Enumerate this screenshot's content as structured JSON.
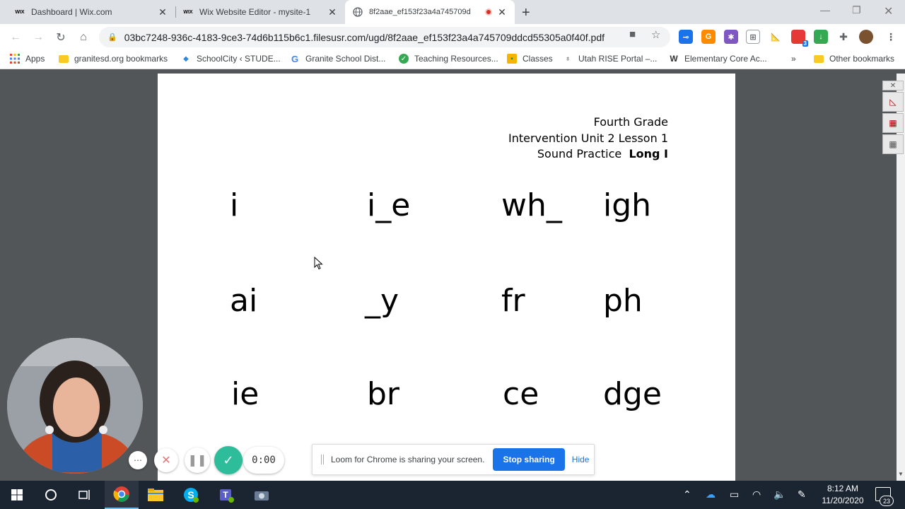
{
  "tabs": [
    {
      "title": "Dashboard | Wix.com",
      "favicon": "wix-icon",
      "favicon_text": "WIX"
    },
    {
      "title": "Wix Website Editor - mysite-1",
      "favicon": "wix-icon",
      "favicon_text": "WIX"
    },
    {
      "title": "8f2aae_ef153f23a4a745709d",
      "favicon": "globe-icon"
    }
  ],
  "toolbar": {
    "url": "03bc7248-936c-4183-9ce3-74d6b115b6c1.filesusr.com/ugd/8f2aae_ef153f23a4a745709ddcd55305a0f40f.pdf",
    "extension_badge": "3"
  },
  "bookmarks": [
    {
      "label": "Apps",
      "icon": "apps-grid-icon"
    },
    {
      "label": "granitesd.org bookmarks",
      "icon": "folder-icon"
    },
    {
      "label": "SchoolCity ‹ STUDE...",
      "icon": "schoolcity-icon"
    },
    {
      "label": "Granite School Dist...",
      "icon": "google-icon"
    },
    {
      "label": "Teaching Resources...",
      "icon": "teaching-resources-icon"
    },
    {
      "label": "Classes",
      "icon": "classroom-icon"
    },
    {
      "label": "Utah RISE Portal –...",
      "icon": "rise-icon"
    },
    {
      "label": "Elementary Core Ac...",
      "icon": "w-icon"
    },
    {
      "label": "Other bookmarks",
      "icon": "folder-icon"
    }
  ],
  "pdf": {
    "header": {
      "line1": "Fourth Grade",
      "line2": "Intervention Unit 2 Lesson 1",
      "line3_prefix": "Sound Practice",
      "line3_bold": "Long I"
    },
    "rows": [
      [
        "i",
        "i_e",
        "wh_",
        "igh"
      ],
      [
        "ai",
        "_y",
        "fr",
        "ph"
      ],
      [
        "ie",
        "br",
        "ce",
        "dge"
      ]
    ]
  },
  "loom": {
    "timer": "0:00",
    "sharing_text": "Loom for Chrome is sharing your screen.",
    "stop_label": "Stop sharing",
    "hide_label": "Hide"
  },
  "taskbar": {
    "time": "8:12 AM",
    "date": "11/20/2020",
    "notification_count": "23"
  }
}
